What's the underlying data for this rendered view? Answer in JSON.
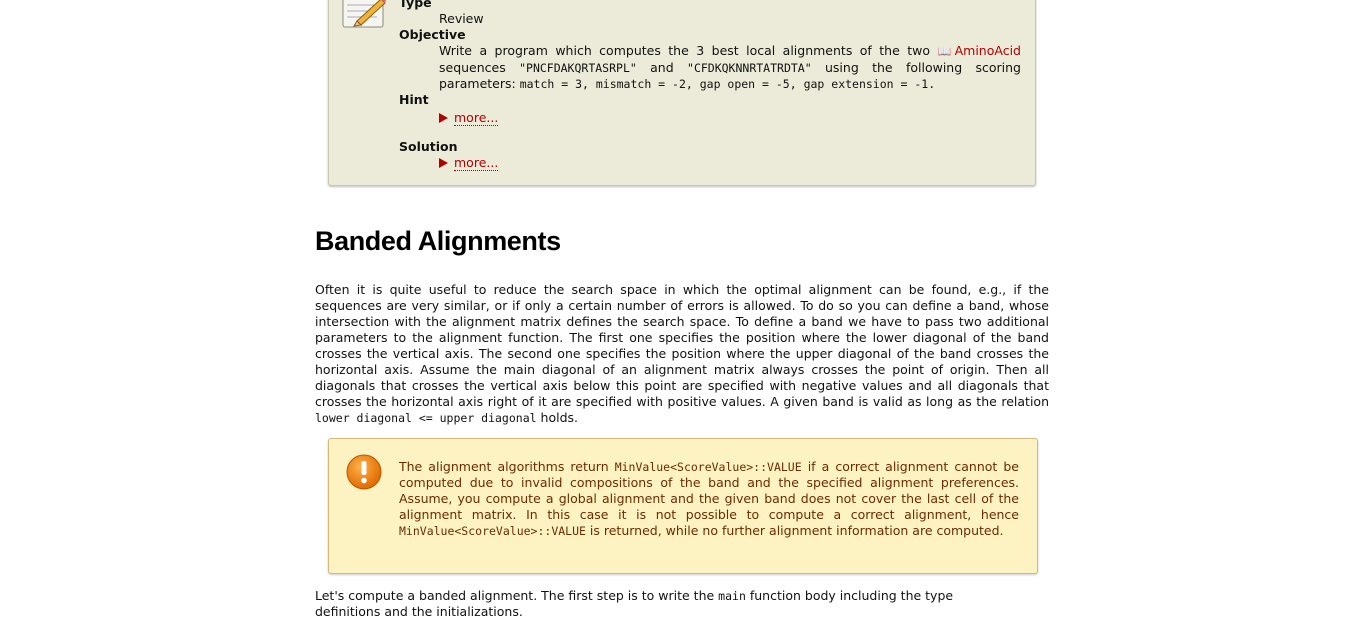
{
  "assignment": {
    "type_label": "Type",
    "type_value": "Review",
    "objective_label": "Objective",
    "objective_text_before": "Write a program which computes the 3 best local alignments of the two ",
    "objective_link": "AminoAcid",
    "objective_text_mid1": " sequences ",
    "seq1": "\"PNCFDAKQRTASRPL\"",
    "objective_text_mid2": " and ",
    "seq2": "\"CFDKQKNNRTATRDTA\"",
    "objective_text_mid3": " using the following scoring parameters: ",
    "scoring": "match = 3, mismatch = -2, gap open = -5, gap extension = -1.",
    "hint_label": "Hint",
    "hint_more": "more...",
    "solution_label": "Solution",
    "solution_more": "more..."
  },
  "section": {
    "title": "Banded Alignments",
    "paragraph_part1": "Often it is quite useful to reduce the search space in which the optimal alignment can be found, e.g., if the sequences are very similar, or if only a certain number of errors is allowed. To do so you can define a band, whose intersection with the alignment matrix defines the search space. To define a band we have to pass two additional parameters to the alignment function. The first one specifies the position where the lower diagonal of the band crosses the vertical axis. The second one specifies the position where the upper diagonal of the band crosses the horizontal axis. Assume the main diagonal of an alignment matrix always crosses the point of origin. Then all diagonals that crosses the vertical axis below this point are specified with negative values and all diagonals that crosses the horizontal axis right of it are specified with positive values. A given band is valid as long as the relation ",
    "paragraph_code": "lower diagonal <= upper diagonal",
    "paragraph_part2": " holds."
  },
  "warning": {
    "text1": "The alignment algorithms return ",
    "code1": "MinValue<ScoreValue>::VALUE",
    "text2": " if a correct alignment cannot be computed due to invalid compositions of the band and the specified alignment preferences. Assume, you compute a global alignment and the given band does not cover the last cell of the alignment matrix. In this case it is not possible to compute a correct alignment, hence ",
    "code2": "MinValue<ScoreValue>::VALUE",
    "text3": " is returned, while no further alignment information are computed."
  },
  "next": {
    "text1": "Let's compute a banded alignment. The first step is to write the ",
    "code": "main",
    "text2": " function body including the type definitions and the initializations."
  },
  "colors": {
    "link": "#b30000",
    "assignment_bg": "#ecebd9",
    "warning_bg": "#fdf3c2"
  },
  "icons": {
    "assignment": "pencil-notepad-icon",
    "warning": "exclamation-icon",
    "link": "book-icon"
  }
}
